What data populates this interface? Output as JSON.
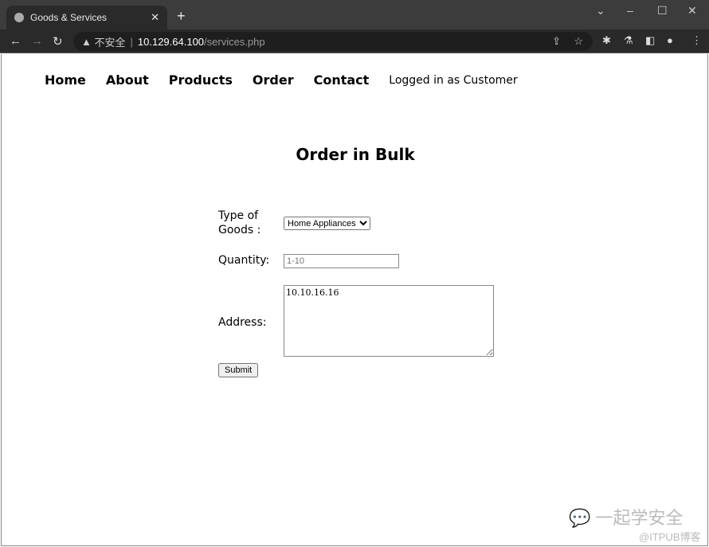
{
  "browser": {
    "tab_title": "Goods & Services",
    "insecure_label": "不安全",
    "url_host": "10.129.64.100",
    "url_path": "/services.php"
  },
  "nav": {
    "items": [
      "Home",
      "About",
      "Products",
      "Order",
      "Contact"
    ],
    "status": "Logged in as Customer"
  },
  "title": "Order in Bulk",
  "form": {
    "type_label": "Type of Goods :",
    "type_value": "Home Appliances",
    "quantity_label": "Quantity:",
    "quantity_placeholder": "1-10",
    "address_label": "Address:",
    "address_value": "10.10.16.16",
    "submit": "Submit"
  },
  "watermark": {
    "main": "一起学安全",
    "sub": "@ITPUB博客"
  }
}
